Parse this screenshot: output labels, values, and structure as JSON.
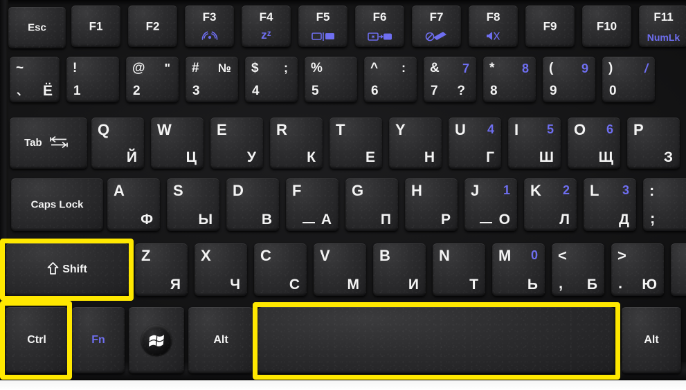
{
  "photo": {
    "subject": "Acer laptop keyboard, Russian / Cyrillic layout",
    "highlight_color": "#ffe800",
    "legend_white": "#f4f4f4",
    "legend_blue": "#6e6ef0",
    "highlighted_keys": [
      "Shift",
      "Ctrl",
      "Spacebar"
    ]
  },
  "rows": {
    "function_row": [
      {
        "id": "esc",
        "label": "Esc"
      },
      {
        "id": "f1",
        "label": "F1"
      },
      {
        "id": "f2",
        "label": "F2"
      },
      {
        "id": "f3",
        "label": "F3",
        "sub_icon": "wifi-icon"
      },
      {
        "id": "f4",
        "label": "F4",
        "sub": "zᶻ",
        "sub_icon": "sleep-icon"
      },
      {
        "id": "f5",
        "label": "F5",
        "sub_icon": "display-toggle-icon"
      },
      {
        "id": "f6",
        "label": "F6",
        "sub_icon": "screen-blank-icon"
      },
      {
        "id": "f7",
        "label": "F7",
        "sub_icon": "touchpad-off-icon"
      },
      {
        "id": "f8",
        "label": "F8",
        "sub_icon": "mute-icon"
      },
      {
        "id": "f9",
        "label": "F9"
      },
      {
        "id": "f10",
        "label": "F10"
      },
      {
        "id": "f11",
        "label": "F11",
        "sub": "NumLk"
      }
    ],
    "number_row": [
      {
        "id": "tilde",
        "top_left": "~",
        "bottom_left": "、",
        "bottom_right": "Ё"
      },
      {
        "id": "1",
        "top_left": "!",
        "bottom_left": "1"
      },
      {
        "id": "2",
        "top_left": "@",
        "top_right_white": "\"",
        "bottom_left": "2"
      },
      {
        "id": "3",
        "top_left": "#",
        "top_right_white": "№",
        "bottom_left": "3"
      },
      {
        "id": "4",
        "top_left": "$",
        "top_right_white": ";",
        "bottom_left": "4"
      },
      {
        "id": "5",
        "top_left": "%",
        "bottom_left": "5"
      },
      {
        "id": "6",
        "top_left": "^",
        "top_right_white": ":",
        "bottom_left": "6"
      },
      {
        "id": "7",
        "top_left": "&",
        "top_right_blue": "7",
        "bottom_left": "7",
        "bottom_right": "?"
      },
      {
        "id": "8",
        "top_left": "*",
        "top_right_blue": "8",
        "bottom_left": "8"
      },
      {
        "id": "9",
        "top_left": "(",
        "top_right_blue": "9",
        "bottom_left": "9"
      },
      {
        "id": "0",
        "top_left": ")",
        "top_right_blue": "/",
        "bottom_left": "0"
      }
    ],
    "qwerty_row": [
      {
        "id": "tab",
        "label": "Tab",
        "icon": "tab-arrows-icon"
      },
      {
        "id": "q",
        "latin": "Q",
        "cyrillic": "Й"
      },
      {
        "id": "w",
        "latin": "W",
        "cyrillic": "Ц"
      },
      {
        "id": "e",
        "latin": "E",
        "cyrillic": "У"
      },
      {
        "id": "r",
        "latin": "R",
        "cyrillic": "К"
      },
      {
        "id": "t",
        "latin": "T",
        "cyrillic": "Е"
      },
      {
        "id": "y",
        "latin": "Y",
        "cyrillic": "Н"
      },
      {
        "id": "u",
        "latin": "U",
        "cyrillic": "Г",
        "numlk": "4"
      },
      {
        "id": "i",
        "latin": "I",
        "cyrillic": "Ш",
        "numlk": "5"
      },
      {
        "id": "o",
        "latin": "O",
        "cyrillic": "Щ",
        "numlk": "6"
      },
      {
        "id": "p",
        "latin": "P",
        "cyrillic": "З"
      }
    ],
    "home_row": [
      {
        "id": "capslock",
        "label": "Caps Lock"
      },
      {
        "id": "a",
        "latin": "A",
        "cyrillic": "Ф"
      },
      {
        "id": "s",
        "latin": "S",
        "cyrillic": "Ы"
      },
      {
        "id": "d",
        "latin": "D",
        "cyrillic": "В"
      },
      {
        "id": "f",
        "latin": "F",
        "cyrillic": "А",
        "homebar": true
      },
      {
        "id": "g",
        "latin": "G",
        "cyrillic": "П"
      },
      {
        "id": "h",
        "latin": "H",
        "cyrillic": "Р"
      },
      {
        "id": "j",
        "latin": "J",
        "cyrillic": "О",
        "numlk": "1",
        "homebar": true
      },
      {
        "id": "k",
        "latin": "K",
        "cyrillic": "Л",
        "numlk": "2"
      },
      {
        "id": "l",
        "latin": "L",
        "cyrillic": "Д",
        "numlk": "3"
      },
      {
        "id": "semicolon",
        "latin": ":",
        "cyrillic": ";"
      }
    ],
    "shift_row": [
      {
        "id": "lshift",
        "label": "Shift",
        "icon": "shift-arrow-icon",
        "highlighted": true
      },
      {
        "id": "z",
        "latin": "Z",
        "cyrillic": "Я"
      },
      {
        "id": "x",
        "latin": "X",
        "cyrillic": "Ч"
      },
      {
        "id": "c",
        "latin": "C",
        "cyrillic": "С"
      },
      {
        "id": "v",
        "latin": "V",
        "cyrillic": "М"
      },
      {
        "id": "b",
        "latin": "B",
        "cyrillic": "И"
      },
      {
        "id": "n",
        "latin": "N",
        "cyrillic": "Т"
      },
      {
        "id": "m",
        "latin": "M",
        "cyrillic": "Ь",
        "numlk": "0"
      },
      {
        "id": "comma",
        "latin": "<",
        "bottom_left": ",",
        "cyrillic": "Б"
      },
      {
        "id": "period",
        "latin": ">",
        "bottom_left": ".",
        "cyrillic": "Ю"
      }
    ],
    "bottom_row": [
      {
        "id": "ctrl",
        "label": "Ctrl",
        "highlighted": true
      },
      {
        "id": "fn",
        "label": "Fn",
        "blue": true
      },
      {
        "id": "win",
        "label": "",
        "icon": "windows-logo-icon"
      },
      {
        "id": "alt_left",
        "label": "Alt"
      },
      {
        "id": "space",
        "label": "",
        "highlighted": true
      },
      {
        "id": "alt_right",
        "label": "Alt"
      }
    ]
  }
}
